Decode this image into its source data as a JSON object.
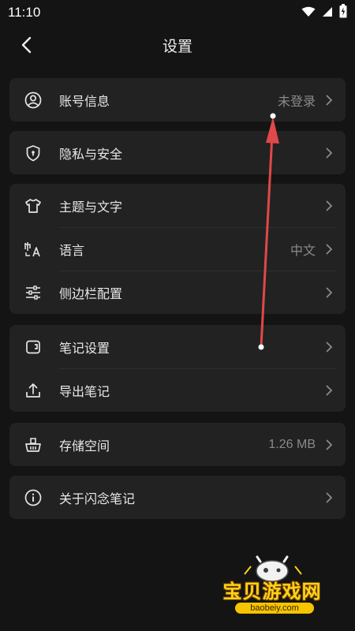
{
  "status_bar": {
    "time": "11:10"
  },
  "header": {
    "title": "设置"
  },
  "groups": [
    {
      "items": [
        {
          "label": "账号信息",
          "value": "未登录",
          "icon": "user-circle-icon"
        }
      ]
    },
    {
      "items": [
        {
          "label": "隐私与安全",
          "icon": "shield-lock-icon"
        }
      ]
    },
    {
      "items": [
        {
          "label": "主题与文字",
          "icon": "tshirt-icon"
        },
        {
          "label": "语言",
          "value": "中文",
          "icon": "translate-icon"
        },
        {
          "label": "侧边栏配置",
          "icon": "sliders-icon"
        }
      ]
    },
    {
      "items": [
        {
          "label": "笔记设置",
          "icon": "wallet-note-icon"
        },
        {
          "label": "导出笔记",
          "icon": "upload-icon"
        }
      ]
    },
    {
      "items": [
        {
          "label": "存储空间",
          "value": "1.26 MB",
          "icon": "storage-basket-icon"
        }
      ]
    },
    {
      "items": [
        {
          "label": "关于闪念笔记",
          "icon": "info-circle-icon"
        }
      ]
    }
  ],
  "watermark": {
    "text": "宝贝游戏网",
    "url": "baobeiy.com"
  },
  "colors": {
    "background": "#141414",
    "card": "#222222",
    "annotation_arrow": "#e0484a",
    "watermark": "#ffd21a"
  }
}
